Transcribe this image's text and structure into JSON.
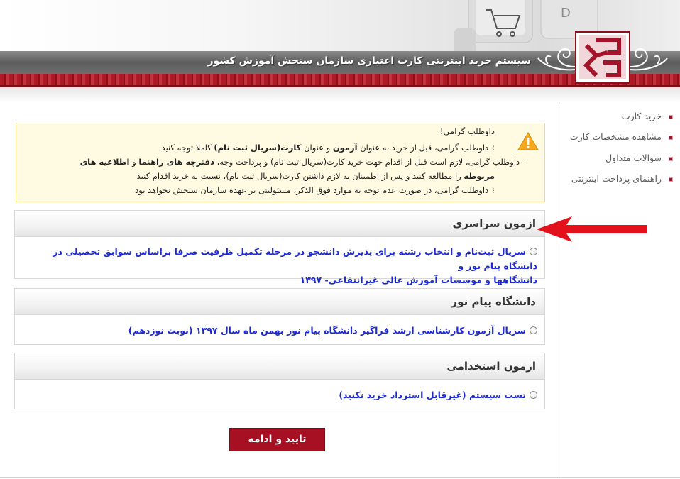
{
  "header": {
    "site_title": "سیستم خرید اینترنتی کارت اعتباری سازمان سنجش آموزش کشور"
  },
  "sidebar": {
    "items": [
      {
        "label": "خرید کارت"
      },
      {
        "label": "مشاهده مشخصات کارت"
      },
      {
        "label": "سوالات متداول"
      },
      {
        "label": "راهنمای پرداخت اینترنتی"
      }
    ]
  },
  "notice": {
    "greeting": "داوطلب گرامی!",
    "line1_a": "داوطلب گرامی، قبل از خرید به عنوان",
    "line1_b": "آزمون",
    "line1_c": "و عنوان",
    "line1_d": "کارت(سریال ثبت نام)",
    "line1_e": "کاملا توجه کنید",
    "line2_a": "داوطلب گرامی، لازم است قبل از اقدام جهت خرید کارت(سریال ثبت نام) و پرداخت وجه،",
    "line2_b": "دفترچه های راهنما",
    "line2_c": "و",
    "line2_d": "اطلاعیه های",
    "line3_a": "مربوطه",
    "line3_b": "را مطالعه کنید و پس از اطمینان به لازم داشتن کارت(سریال ثبت نام)، نسبت به خرید اقدام کنید",
    "line4": "داوطلب گرامی، در صورت عدم توجه به موارد فوق الذکر، مسئولیتی بر عهده سازمان سنجش نخواهد بود"
  },
  "sections": [
    {
      "title": "ازمون سراسری",
      "options": [
        {
          "line1": "سریال ثبت‌نام و انتخاب رشته برای پذیرش دانشجو در مرحله تکمیل ظرفیت صرفا براساس سوابق تحصیلی در دانشگاه پیام نور و",
          "line2": "دانشگاهها و موسسات آموزش عالی غیرانتفاعی- ۱۳۹۷"
        }
      ]
    },
    {
      "title": "دانشگاه پیام نور",
      "options": [
        {
          "line1": "سریال آزمون کارشناسی ارشد فراگیر دانشگاه پیام نور بهمن ماه سال ۱۳۹۷ (نوبت نوزدهم)"
        }
      ]
    },
    {
      "title": "ازمون استخدامی",
      "options": [
        {
          "line1": "تست سیستم (غیرقابل استرداد خرید نکنید)"
        }
      ]
    }
  ],
  "submit": {
    "label": "تایید و ادامه"
  },
  "colors": {
    "brand_red": "#a70f22",
    "link_blue": "#1d2ad1",
    "notice_bg": "#fffbe3",
    "title_bar": "#6e6e6e"
  },
  "icons": {
    "notice": "warning-icon",
    "logo": "sanjesh-logo",
    "pointer": "red-arrow"
  }
}
